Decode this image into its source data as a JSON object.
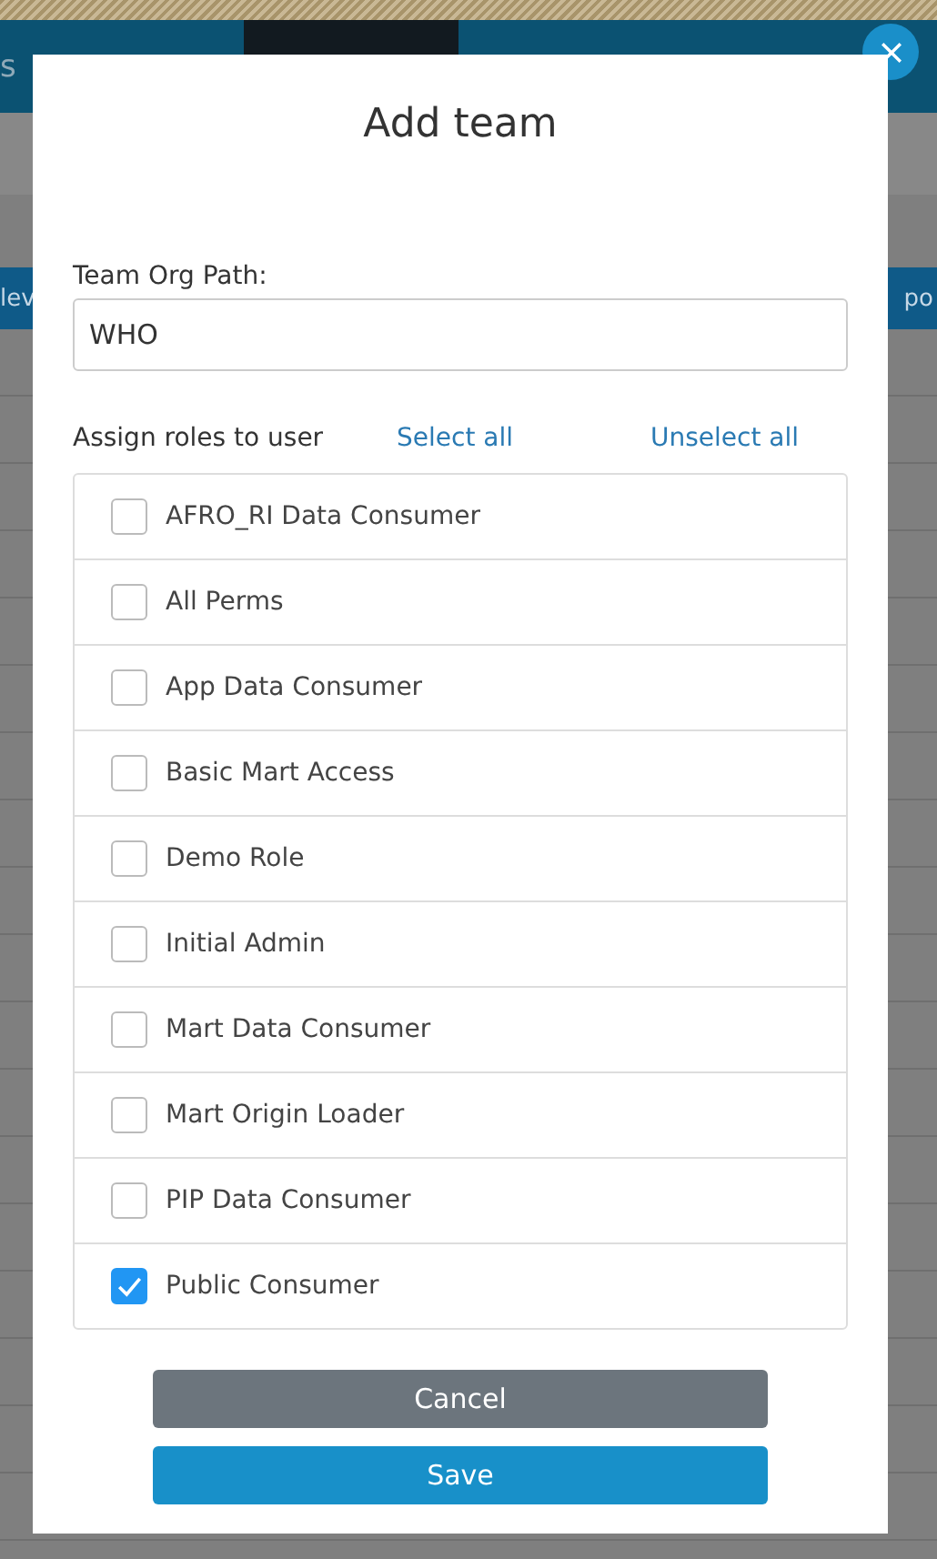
{
  "background": {
    "nav_text": "s",
    "header_left": "lev",
    "header_right": "po"
  },
  "dialog": {
    "title": "Add team",
    "org_path": {
      "label": "Team Org Path:",
      "value": "WHO"
    },
    "roles_label": "Assign roles to user",
    "select_all": "Select all",
    "unselect_all": "Unselect all",
    "roles": [
      {
        "name": "AFRO_RI Data Consumer",
        "checked": false
      },
      {
        "name": "All Perms",
        "checked": false
      },
      {
        "name": "App Data Consumer",
        "checked": false
      },
      {
        "name": "Basic Mart Access",
        "checked": false
      },
      {
        "name": "Demo Role",
        "checked": false
      },
      {
        "name": "Initial Admin",
        "checked": false
      },
      {
        "name": "Mart Data Consumer",
        "checked": false
      },
      {
        "name": "Mart Origin Loader",
        "checked": false
      },
      {
        "name": "PIP Data Consumer",
        "checked": false
      },
      {
        "name": "Public Consumer",
        "checked": true
      }
    ],
    "buttons": [
      "Cancel",
      "Save"
    ]
  }
}
